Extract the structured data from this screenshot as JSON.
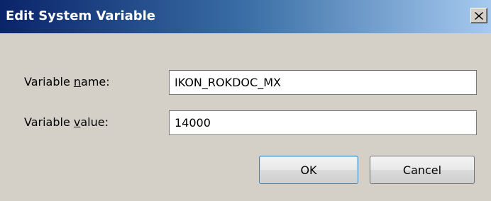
{
  "window": {
    "title": "Edit System Variable"
  },
  "title_bar": {
    "close_icon": "close-x-icon",
    "gradient_colors": [
      "#0a246a",
      "#3a6ea5",
      "#a6caf0"
    ]
  },
  "form": {
    "name": {
      "label_before": "Variable ",
      "label_mnemonic": "n",
      "label_after": "ame:",
      "value": "IKON_ROKDOC_MX"
    },
    "value": {
      "label_before": "Variable ",
      "label_mnemonic": "v",
      "label_after": "alue:",
      "value": "14000"
    }
  },
  "buttons": {
    "ok_label": "OK",
    "cancel_label": "Cancel"
  }
}
